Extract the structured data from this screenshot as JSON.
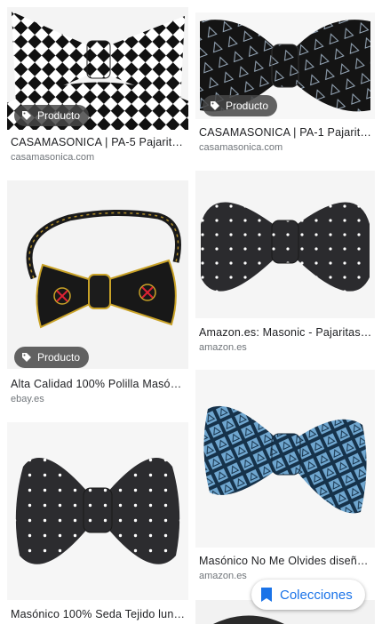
{
  "results": [
    {
      "title": "CASAMASONICA | PA-5 Pajarita ...",
      "source": "casamasonica.com",
      "badge": "Producto"
    },
    {
      "title": "CASAMASONICA | PA-1 Pajarita ...",
      "source": "casamasonica.com",
      "badge": "Producto"
    },
    {
      "title": "Alta Calidad 100% Polilla Masóni...",
      "source": "ebay.es",
      "badge": "Producto"
    },
    {
      "title": "Amazon.es: Masonic - Pajaritas ...",
      "source": "amazon.es"
    },
    {
      "title": "Masónico No Me Olvides diseño ...",
      "source": "amazon.es"
    },
    {
      "title": "Masónico 100% Seda Tejido luna..."
    }
  ],
  "collections_button": {
    "label": "Colecciones",
    "icon": "bookmark-icon"
  },
  "colors": {
    "accent": "#1a73e8",
    "badge_bg": "#464646"
  }
}
